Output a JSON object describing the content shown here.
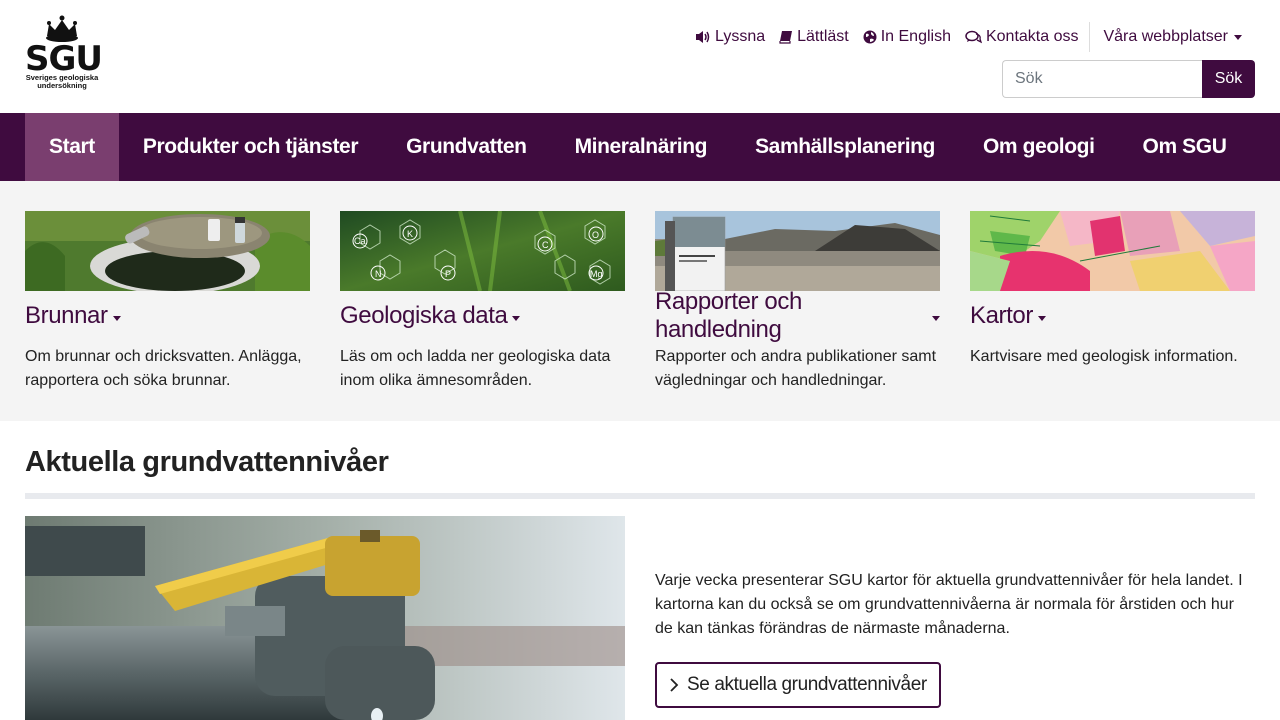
{
  "logo": {
    "wordmark": "SGU",
    "subtitle_line1": "Sveriges geologiska",
    "subtitle_line2": "undersökning"
  },
  "toplinks": [
    {
      "label": "Lyssna",
      "icon": "speaker-icon"
    },
    {
      "label": "Lättläst",
      "icon": "book-icon"
    },
    {
      "label": "In English",
      "icon": "globe-icon"
    },
    {
      "label": "Kontakta oss",
      "icon": "chat-icon"
    }
  ],
  "sites_label": "Våra webbplatser",
  "search": {
    "placeholder": "Sök",
    "button": "Sök"
  },
  "nav": [
    "Start",
    "Produkter och tjänster",
    "Grundvatten",
    "Mineralnäring",
    "Samhällsplanering",
    "Om geologi",
    "Om SGU"
  ],
  "cards": [
    {
      "title": "Brunnar",
      "desc": "Om brunnar och dricksvatten. Anlägga, rapportera och söka brunnar."
    },
    {
      "title": "Geologiska data",
      "desc": "Läs om och ladda ner geologiska data inom olika ämnesområden."
    },
    {
      "title": "Rapporter och handledning",
      "desc": "Rapporter och andra publikationer samt vägledningar och handledningar."
    },
    {
      "title": "Kartor",
      "desc": "Kartvisare med geologisk information."
    }
  ],
  "section": {
    "title": "Aktuella grundvattennivåer",
    "text": "Varje vecka presenterar SGU kartor för aktuella grundvattennivåer för hela landet. I kartorna kan du också se om grundvattennivåerna är normala för årstiden och hur de kan tänkas förändras de närmaste månaderna.",
    "cta": "Se aktuella grundvattennivåer"
  },
  "colors": {
    "brand": "#3f0b3f",
    "nav_active": "#7a3e6f",
    "band_bg": "#f4f4f4"
  }
}
